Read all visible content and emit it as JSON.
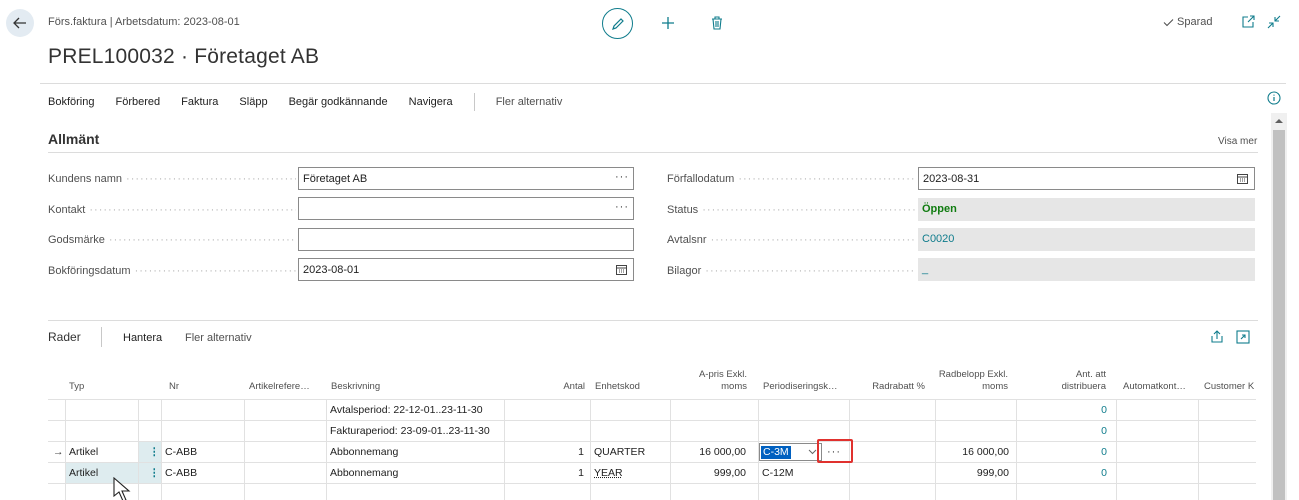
{
  "header": {
    "breadcrumb": "Förs.faktura | Arbetsdatum: 2023-08-01",
    "title": "PREL100032 · Företaget AB",
    "saved_label": "Sparad"
  },
  "actions": {
    "items": [
      "Bokföring",
      "Förbered",
      "Faktura",
      "Släpp",
      "Begär godkännande",
      "Navigera"
    ],
    "more": "Fler alternativ"
  },
  "general": {
    "title": "Allmänt",
    "show_more": "Visa mer",
    "customer_name_label": "Kundens namn",
    "customer_name": "Företaget AB",
    "contact_label": "Kontakt",
    "contact": "",
    "goods_mark_label": "Godsmärke",
    "goods_mark": "",
    "posting_date_label": "Bokföringsdatum",
    "posting_date": "2023-08-01",
    "due_date_label": "Förfallodatum",
    "due_date": "2023-08-31",
    "status_label": "Status",
    "status": "Öppen",
    "contract_no_label": "Avtalsnr",
    "contract_no": "C0020",
    "attachments_label": "Bilagor",
    "attachments": "_"
  },
  "lines": {
    "title": "Rader",
    "manage": "Hantera",
    "more": "Fler alternativ",
    "columns": {
      "type": "Typ",
      "no": "Nr",
      "item_ref": "Artikelrefere…",
      "description": "Beskrivning",
      "quantity": "Antal",
      "unit": "Enhetskod",
      "unit_price_1": "A-pris Exkl.",
      "unit_price_2": "moms",
      "deferral": "Periodiseringsk…",
      "line_discount": "Radrabatt %",
      "line_amount_1": "Radbelopp Exkl.",
      "line_amount_2": "moms",
      "qty_to_distribute_1": "Ant. att",
      "qty_to_distribute_2": "distribuera",
      "auto_cont": "Automatkont…",
      "customer": "Customer K"
    },
    "rows": [
      {
        "type": "",
        "no": "",
        "description": "Avtalsperiod: 22-12-01..23-11-30",
        "quantity": "",
        "unit": "",
        "unit_price": "",
        "deferral": "",
        "line_amount": "",
        "distribute": "0"
      },
      {
        "type": "",
        "no": "",
        "description": "Fakturaperiod: 23-09-01..23-11-30",
        "quantity": "",
        "unit": "",
        "unit_price": "",
        "deferral": "",
        "line_amount": "",
        "distribute": "0"
      },
      {
        "type": "Artikel",
        "no": "C-ABB",
        "description": "Abbonnemang",
        "quantity": "1",
        "unit": "QUARTER",
        "unit_price": "16 000,00",
        "deferral": "C-3M",
        "line_amount": "16 000,00",
        "distribute": "0"
      },
      {
        "type": "Artikel",
        "no": "C-ABB",
        "description": "Abbonnemang",
        "quantity": "1",
        "unit": "YEAR",
        "unit_price": "999,00",
        "deferral": "C-12M",
        "line_amount": "999,00",
        "distribute": "0"
      }
    ],
    "row_marker": "→",
    "row_menu": "⋮",
    "lookup_ellipsis": "···"
  },
  "colors": {
    "accent": "#0f7c8c",
    "status_ok": "#107c10",
    "highlight_box": "#e0312e"
  }
}
